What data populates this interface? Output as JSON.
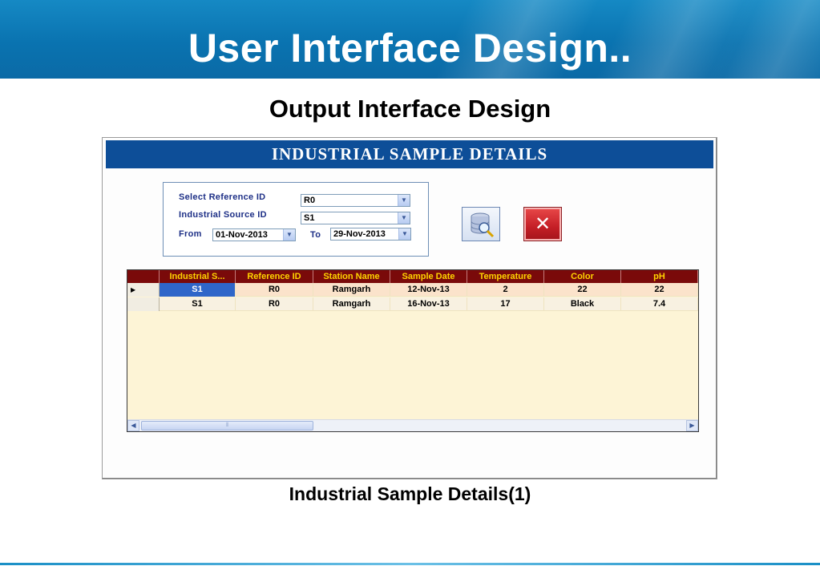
{
  "slide": {
    "title": "User Interface Design..",
    "subtitle": "Output Interface Design",
    "caption": "Industrial Sample Details(1)"
  },
  "form": {
    "title": "INDUSTRIAL SAMPLE DETAILS",
    "filters": {
      "reference_label": "Select Reference ID",
      "reference_value": "R0",
      "source_label": "Industrial Source ID",
      "source_value": "S1",
      "from_label": "From",
      "from_value": "01-Nov-2013",
      "to_label": "To",
      "to_value": "29-Nov-2013"
    },
    "buttons": {
      "search_icon": "database-search-icon",
      "close_icon": "close-icon"
    },
    "grid": {
      "columns": [
        "Industrial S...",
        "Reference ID",
        "Station Name",
        "Sample Date",
        "Temperature",
        "Color",
        "pH"
      ],
      "rows": [
        [
          "S1",
          "R0",
          "Ramgarh",
          "12-Nov-13",
          "2",
          "22",
          "22"
        ],
        [
          "S1",
          "R0",
          "Ramgarh",
          "16-Nov-13",
          "17",
          "Black",
          "7.4"
        ]
      ],
      "colors": {
        "header_bg": "#7a0a0a",
        "header_text": "#ffd400",
        "selected_cell": "#2f66c9",
        "body_bg": "#fdf4d6"
      }
    }
  },
  "colors": {
    "banner": "#0a73b0",
    "form_title_bar": "#0d4e98",
    "label_text": "#1d2f86"
  }
}
